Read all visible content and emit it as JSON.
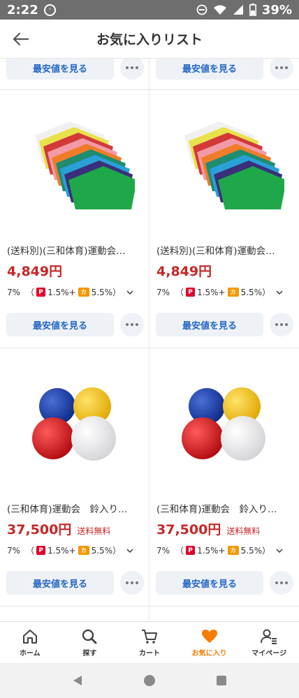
{
  "status_bar": {
    "time": "2:22",
    "battery": "39%",
    "icons": [
      "notification-icon",
      "dnd-icon",
      "wifi-icon",
      "signal-icon",
      "battery-icon"
    ]
  },
  "header": {
    "title": "お気に入りリスト",
    "back_icon": "back-arrow-icon"
  },
  "actions": {
    "cheapest_label": "最安値を見る",
    "more_icon": "more-icon"
  },
  "products": [
    {
      "name": "(送料別)(三和体育)運動会…",
      "price": "4,849円",
      "shipping": "",
      "points": {
        "rate": "7%",
        "open": "（",
        "pay": "1.5%+",
        "card": "5.5%",
        "close": "）"
      },
      "image": "colored-shorts"
    },
    {
      "name": "(送料別)(三和体育)運動会…",
      "price": "4,849円",
      "shipping": "",
      "points": {
        "rate": "7%",
        "open": "（",
        "pay": "1.5%+",
        "card": "5.5%",
        "close": "）"
      },
      "image": "colored-shorts"
    },
    {
      "name": "(三和体育)運動会　鈴入り…",
      "price": "37,500円",
      "shipping": "送料無料",
      "points": {
        "rate": "7%",
        "open": "（",
        "pay": "1.5%+",
        "card": "5.5%",
        "close": "）"
      },
      "image": "colored-balls"
    },
    {
      "name": "(三和体育)運動会　鈴入り…",
      "price": "37,500円",
      "shipping": "送料無料",
      "points": {
        "rate": "7%",
        "open": "（",
        "pay": "1.5%+",
        "card": "5.5%",
        "close": "）"
      },
      "image": "colored-balls"
    }
  ],
  "badges": {
    "pay": "P",
    "card": "カ"
  },
  "bottom_nav": [
    {
      "label": "ホーム",
      "icon": "home-icon",
      "active": false
    },
    {
      "label": "探す",
      "icon": "search-icon",
      "active": false
    },
    {
      "label": "カート",
      "icon": "cart-icon",
      "active": false
    },
    {
      "label": "お気に入り",
      "icon": "heart-icon",
      "active": true
    },
    {
      "label": "マイページ",
      "icon": "user-icon",
      "active": false
    }
  ],
  "colors": {
    "price": "#c62828",
    "link": "#2467c4",
    "active": "#f57c00"
  }
}
